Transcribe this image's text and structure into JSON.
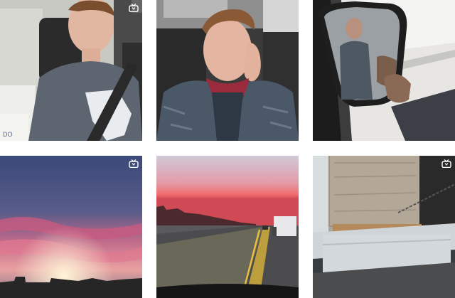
{
  "grid": {
    "posts": [
      {
        "caption": ""
      },
      {
        "caption": ""
      },
      {
        "caption": ""
      },
      {
        "caption": ""
      },
      {
        "caption": ""
      },
      {
        "caption": ""
      }
    ]
  },
  "icons": {
    "post_badge": "igtv-icon"
  },
  "colors": {
    "background": "#ffffff",
    "badge": "#ffffff"
  }
}
